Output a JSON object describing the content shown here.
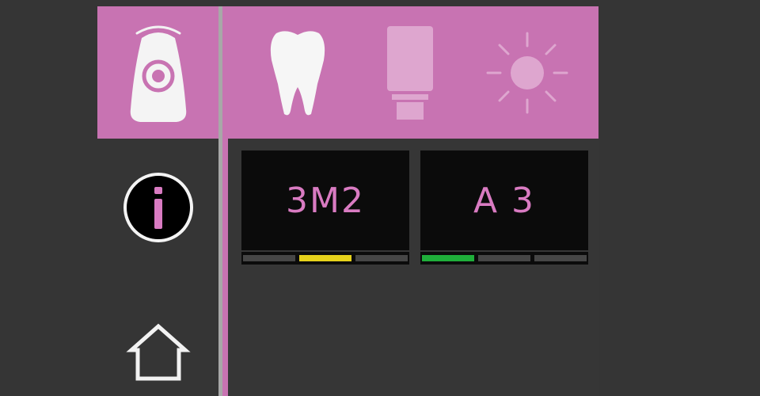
{
  "colors": {
    "brand_pink": "#c873b2",
    "shade_text": "#d97bc2",
    "background": "#353535",
    "indicator_yellow": "#e6d21b",
    "indicator_green": "#1fae3a",
    "indicator_off": "#464646"
  },
  "sidebar": {
    "device_icon": "curing-light-device-icon",
    "info_icon": "info-icon",
    "home_icon": "home-icon"
  },
  "header": {
    "tabs": [
      {
        "icon": "tooth-icon",
        "active": true
      },
      {
        "icon": "light-guide-icon",
        "active": false
      },
      {
        "icon": "sun-icon",
        "active": false
      }
    ]
  },
  "shades": [
    {
      "label": "3M2",
      "active_segment": 1,
      "indicator_color": "#e6d21b"
    },
    {
      "label": "A 3",
      "active_segment": 0,
      "indicator_color": "#1fae3a"
    }
  ]
}
